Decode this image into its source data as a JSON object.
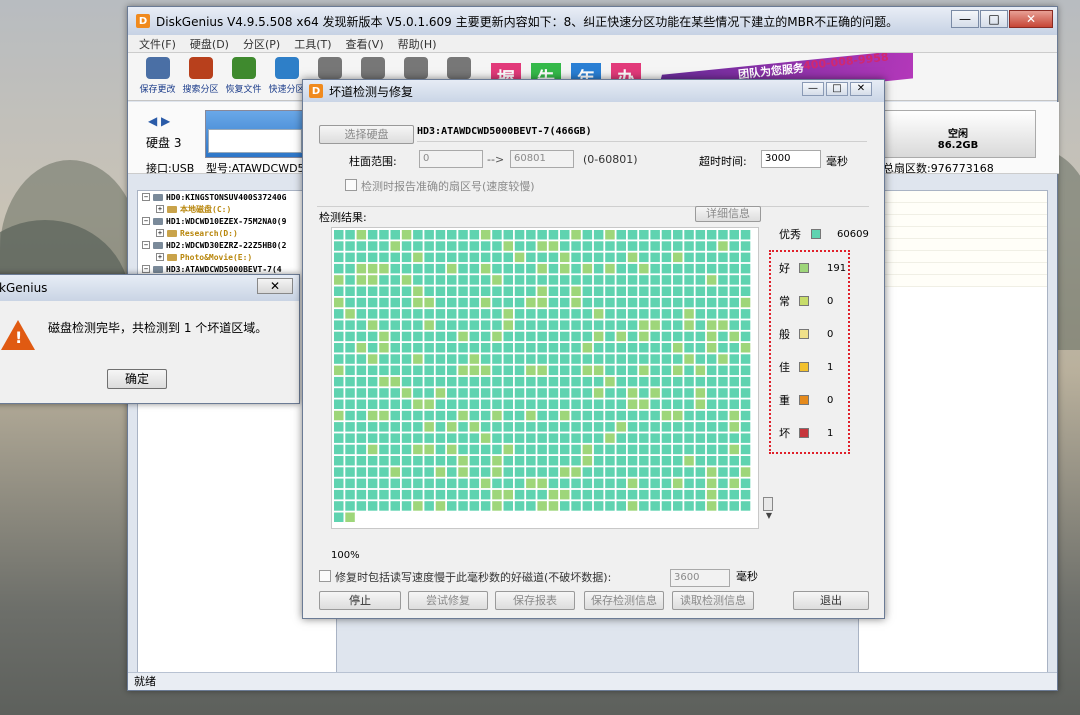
{
  "app": {
    "title": "DiskGenius V4.9.5.508 x64   发现新版本 V5.0.1.609 主要更新内容如下：8、纠正快速分区功能在某些情况下建立的MBR不正确的问题。",
    "menu": [
      "文件(F)",
      "硬盘(D)",
      "分区(P)",
      "工具(T)",
      "查看(V)",
      "帮助(H)"
    ],
    "toolbar": [
      {
        "label": "保存更改",
        "icon": "save-icon",
        "color": "#4a6fa5"
      },
      {
        "label": "搜索分区",
        "icon": "magnifier-icon",
        "color": "#b8401c"
      },
      {
        "label": "恢复文件",
        "icon": "recover-box-icon",
        "color": "#3f8a2e"
      },
      {
        "label": "快速分区",
        "icon": "quick-partition-icon",
        "color": "#2e7fc8"
      },
      {
        "label": "",
        "icon": "disk-icon",
        "color": "#777777"
      },
      {
        "label": "",
        "icon": "cancel-icon",
        "color": "#777777"
      },
      {
        "label": "",
        "icon": "trash-icon",
        "color": "#777777"
      },
      {
        "label": "",
        "icon": "disc-icon",
        "color": "#777777"
      }
    ],
    "banner": {
      "chars": [
        "握",
        "失",
        "年",
        "办"
      ],
      "text": "团队为您服务",
      "phone": "400-008-9958"
    },
    "disk": {
      "label": "硬盘 3",
      "interface": "接口:USB",
      "model": "型号:ATAWDCWD500",
      "free_label": "空闲",
      "free_size": "86.2GB",
      "total_sectors": "总扇区数:976773168"
    },
    "tree": [
      {
        "text": "HD0:KINGSTONSUV400S37240G",
        "color": "#000000",
        "level": 0
      },
      {
        "text": "本地磁盘(C:)",
        "color": "#b8860b",
        "level": 1
      },
      {
        "text": "HD1:WDCWD10EZEX-75M2NA0(9",
        "color": "#000000",
        "level": 0
      },
      {
        "text": "Research(D:)",
        "color": "#b8860b",
        "level": 1
      },
      {
        "text": "HD2:WDCWD30EZRZ-22Z5HB0(2",
        "color": "#000000",
        "level": 0
      },
      {
        "text": "Photo&Movie(E:)",
        "color": "#b8860b",
        "level": 1
      },
      {
        "text": "HD3:ATAWDCWD5000BEVT-7(4",
        "color": "#000000",
        "level": 0
      }
    ],
    "status": "就绪"
  },
  "msgbox": {
    "title": "kGenius",
    "message": "磁盘检测完毕，共检测到 1 个坏道区域。",
    "ok": "确定"
  },
  "dialog": {
    "title": "坏道检测与修复",
    "select_disk": "选择硬盘",
    "disk_name": "HD3:ATAWDCWD5000BEVT-7(466GB)",
    "cyl_label": "柱面范围:",
    "cyl_from": "0",
    "arrow": "-->",
    "cyl_to": "60801",
    "cyl_range": "(0-60801)",
    "timeout_label": "超时时间:",
    "timeout_value": "3000",
    "ms": "毫秒",
    "report_check": "检测时报告准确的扇区号(速度较慢)",
    "result_label": "检测结果:",
    "detail_btn": "详细信息",
    "progress": "100%",
    "repair_check": "修复时包括读写速度慢于此毫秒数的好磁道(不破坏数据):",
    "repair_ms": "3600",
    "buttons": {
      "stop": "停止",
      "try_repair": "尝试修复",
      "save_report": "保存报表",
      "save_result": "保存检测信息",
      "load_result": "读取检测信息",
      "exit": "退出"
    },
    "legend": [
      {
        "name": "优秀",
        "value": "60609",
        "color": "#5fd3b0"
      },
      {
        "name": "好",
        "value": "191",
        "color": "#9ed67a"
      },
      {
        "name": "常",
        "value": "0",
        "color": "#c7dc6a"
      },
      {
        "name": "般",
        "value": "0",
        "color": "#efe08a"
      },
      {
        "name": "佳",
        "value": "1",
        "color": "#f2c12e"
      },
      {
        "name": "重",
        "value": "0",
        "color": "#e58a1c"
      },
      {
        "name": "坏",
        "value": "1",
        "color": "#c6363c"
      }
    ]
  }
}
